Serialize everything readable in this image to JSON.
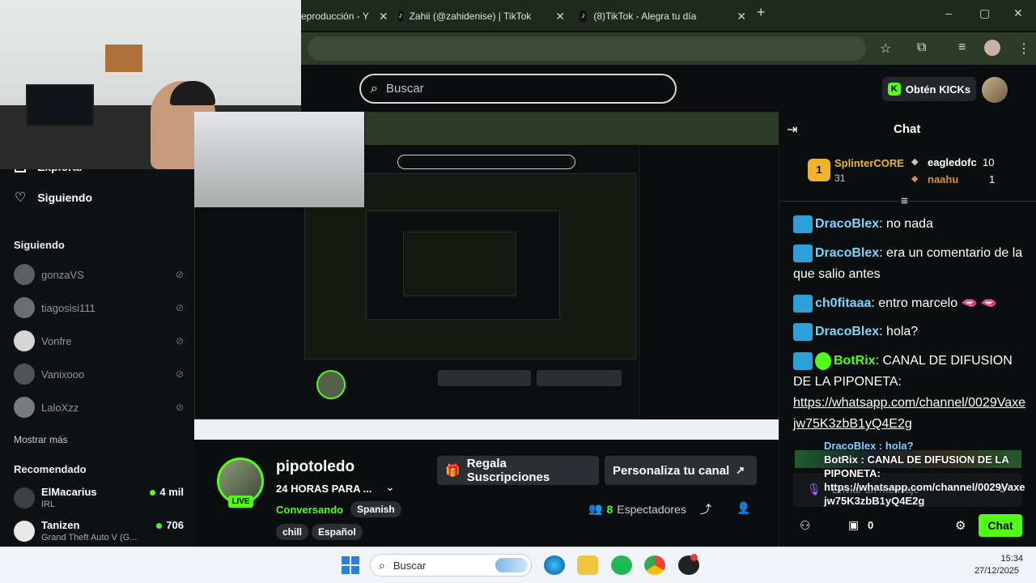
{
  "browser": {
    "tabs": [
      {
        "title": "eproducción - Y"
      },
      {
        "title": "Zahii (@zahidenise) | TikTok"
      },
      {
        "title": "(8)TikTok - Alegra tu día"
      }
    ],
    "new_tab": "+",
    "window_controls": [
      "–",
      "▢",
      "✕"
    ]
  },
  "header": {
    "search_placeholder": "Buscar",
    "get_kicks": "Obtén KICKs"
  },
  "sidebar": {
    "explore": "Explorar",
    "following": "Siguiendo",
    "following_title": "Siguiendo",
    "following_users": [
      {
        "name": "gonzaVS"
      },
      {
        "name": "tiagosisi111"
      },
      {
        "name": "Vonfre"
      },
      {
        "name": "Vanixooo"
      },
      {
        "name": "LaloXzz"
      }
    ],
    "show_more": "Mostrar más",
    "recommended_title": "Recomendado",
    "recommended": [
      {
        "name": "ElMacarius",
        "category": "IRL",
        "viewers": "4 mil"
      },
      {
        "name": "Tanizen",
        "category": "Grand Theft Auto V (G...",
        "viewers": "706"
      }
    ]
  },
  "stream": {
    "username": "pipotoledo",
    "title": "24 HORAS PARA ...",
    "category": "Conversando",
    "language_tag": "Spanish",
    "tags": [
      "chill",
      "Español"
    ],
    "live_label": "LIVE",
    "gift_subs": "Regala Suscripciones",
    "customize_channel": "Personaliza tu canal",
    "viewers_count": "8",
    "viewers_label": "Espectadores"
  },
  "chat": {
    "title": "Chat",
    "leaderboard": [
      {
        "name": "SplinterCORE",
        "value": "31",
        "rank": "1"
      },
      {
        "name": "eagledofc",
        "value": "10"
      },
      {
        "name": "naahu",
        "value": "1"
      }
    ],
    "messages": [
      {
        "user": "DracoBlex",
        "text": ": no nada"
      },
      {
        "user": "DracoBlex",
        "text": ": era un comentario de la que salio antes"
      },
      {
        "user": "ch0fitaaa",
        "text": ": entro marcelo 🫦 🫦"
      },
      {
        "user": "DracoBlex",
        "text": ": hola?"
      },
      {
        "user": "BotRix",
        "text": ": CANAL DE DIFUSION DE LA PIPONETA:",
        "link": "https://whatsapp.com/channel/0029Vaxejw75K3zbB1yQ4E2g"
      }
    ],
    "overlay_lines": [
      "DracoBlex : hola?",
      "BotRix : CANAL DE DIFUSION DE LA",
      "PIPONETA:",
      "https://whatsapp.com/channel/0029Vaxe",
      "jw75K3zbB1yQ4E2g"
    ],
    "input_placeholder": "Enviar un mensaje",
    "kicks_count": "0",
    "send_label": "Chat"
  },
  "taskbar": {
    "search_placeholder": "Buscar",
    "time": "15:34",
    "date": "27/12/2025"
  },
  "colors": {
    "kick_green": "#53fc18",
    "background": "#0b0e0f",
    "link_blue": "#7dd4ff"
  }
}
